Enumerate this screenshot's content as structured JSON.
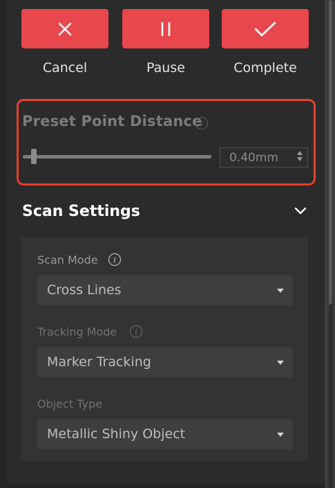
{
  "actions": {
    "cancel_label": "Cancel",
    "pause_label": "Pause",
    "complete_label": "Complete"
  },
  "colors": {
    "action_red": "#e8474d",
    "highlight_border": "#e5402b"
  },
  "preset": {
    "title": "Preset Point Distance",
    "value": "0.40mm",
    "slider_level": 0.06
  },
  "scan_settings": {
    "title": "Scan Settings",
    "scan_mode_label": "Scan Mode",
    "scan_mode_value": "Cross Lines",
    "tracking_mode_label": "Tracking Mode",
    "tracking_mode_value": "Marker Tracking",
    "object_type_label": "Object Type",
    "object_type_value": "Metallic Shiny Object"
  },
  "icons": {
    "cancel": "close-icon",
    "pause": "pause-icon",
    "complete": "checkmark-icon",
    "info": "info-icon",
    "collapse": "chevron-down-icon"
  }
}
